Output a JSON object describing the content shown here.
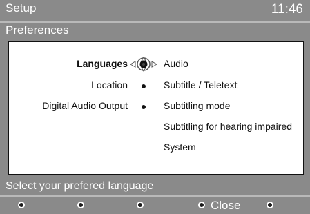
{
  "header": {
    "title": "Setup",
    "clock": "11:46"
  },
  "breadcrumb": "Preferences",
  "menu": {
    "left_items": [
      {
        "label": "Languages",
        "active": true
      },
      {
        "label": "Location"
      },
      {
        "label": "Digital Audio Output"
      }
    ],
    "right_items": [
      "Audio",
      "Subtitle / Teletext",
      "Subtitling mode",
      "Subtitling for hearing impaired",
      "System"
    ]
  },
  "hint": "Select your prefered language",
  "footer": {
    "close_label": "Close"
  },
  "colors": {
    "background": "#8a8a8a",
    "panel": "#ffffff",
    "text_dark": "#111111",
    "text_light": "#ffffff"
  }
}
